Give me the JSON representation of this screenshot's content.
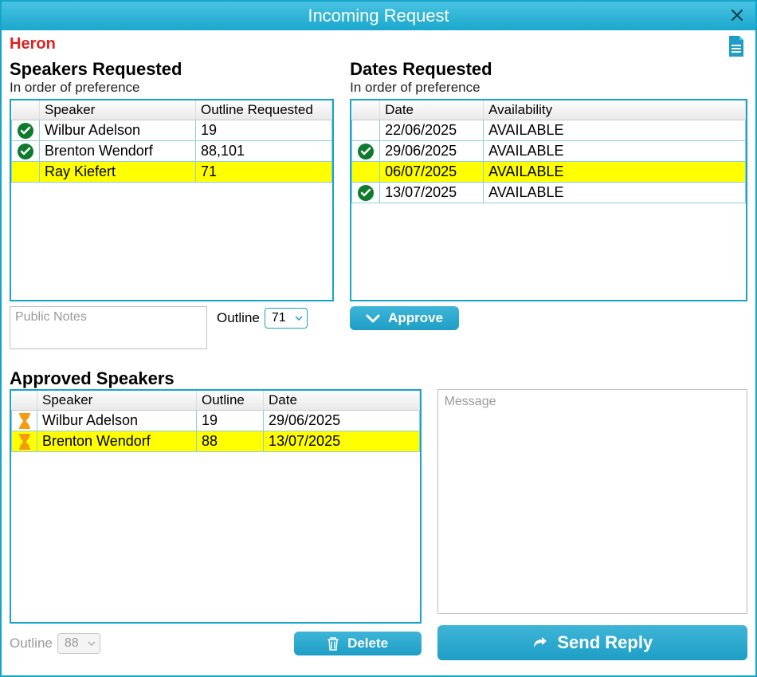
{
  "window": {
    "title": "Incoming Request"
  },
  "congregation": "Heron",
  "sections": {
    "speakers_requested": {
      "title": "Speakers Requested",
      "sub": "In order of preference"
    },
    "dates_requested": {
      "title": "Dates Requested",
      "sub": "In order of preference"
    },
    "approved_speakers": {
      "title": "Approved Speakers"
    }
  },
  "headers": {
    "speaker": "Speaker",
    "outline_requested": "Outline Requested",
    "date": "Date",
    "availability": "Availability",
    "outline": "Outline"
  },
  "speakers": [
    {
      "status": "check",
      "name": "Wilbur Adelson",
      "outline": "19",
      "highlight": false
    },
    {
      "status": "check",
      "name": "Brenton Wendorf",
      "outline": "88,101",
      "highlight": false
    },
    {
      "status": "",
      "name": "Ray Kiefert",
      "outline": "71",
      "highlight": true
    }
  ],
  "dates": [
    {
      "status": "",
      "date": "22/06/2025",
      "availability": "AVAILABLE",
      "highlight": false
    },
    {
      "status": "check",
      "date": "29/06/2025",
      "availability": "AVAILABLE",
      "highlight": false
    },
    {
      "status": "",
      "date": "06/07/2025",
      "availability": "AVAILABLE",
      "highlight": true
    },
    {
      "status": "check",
      "date": "13/07/2025",
      "availability": "AVAILABLE",
      "highlight": false
    }
  ],
  "approved": [
    {
      "status": "hourglass",
      "name": "Wilbur Adelson",
      "outline": "19",
      "date": "29/06/2025",
      "highlight": false
    },
    {
      "status": "hourglass",
      "name": "Brenton Wendorf",
      "outline": "88",
      "date": "13/07/2025",
      "highlight": true
    }
  ],
  "controls": {
    "public_notes_placeholder": "Public Notes",
    "outline_label": "Outline",
    "outline_value": "71",
    "approve_label": "Approve",
    "approved_outline_label": "Outline",
    "approved_outline_value": "88",
    "delete_label": "Delete",
    "message_placeholder": "Message",
    "send_reply_label": "Send Reply"
  }
}
